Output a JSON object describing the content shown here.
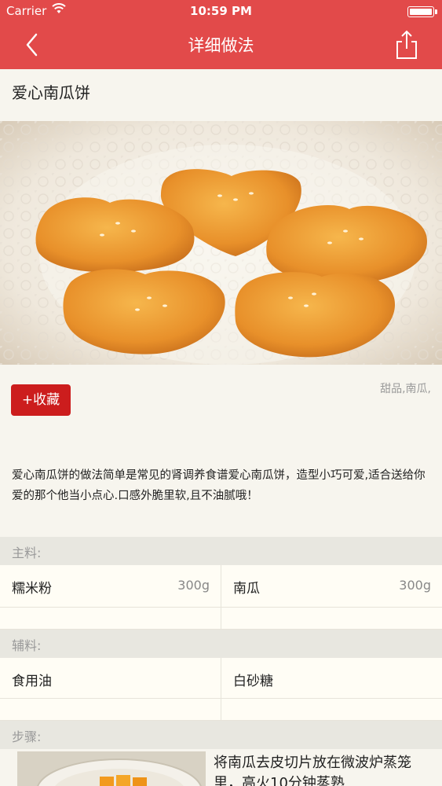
{
  "status": {
    "carrier": "Carrier",
    "time": "10:59 PM"
  },
  "nav": {
    "title": "详细做法",
    "back_icon": "chevron-left-icon",
    "share_icon": "share-icon"
  },
  "recipe": {
    "name": "爱心南瓜饼",
    "favorite_label": "+收藏",
    "tags": "甜品,南瓜,",
    "description": "爱心南瓜饼的做法简单是常见的肾调养食谱爱心南瓜饼，造型小巧可爱,适合送给你爱的那个他当小点心.口感外脆里软,且不油腻哦！"
  },
  "main_ingredients": {
    "label": "主料:",
    "items": [
      {
        "name": "糯米粉",
        "qty": "300g"
      },
      {
        "name": "南瓜",
        "qty": "300g"
      }
    ]
  },
  "aux_ingredients": {
    "label": "辅料:",
    "items": [
      {
        "name": "食用油",
        "qty": ""
      },
      {
        "name": "白砂糖",
        "qty": ""
      }
    ]
  },
  "steps": {
    "label": "步骤:",
    "items": [
      {
        "text": "将南瓜去皮切片放在微波炉蒸笼里，高火10分钟蒸熟"
      }
    ]
  },
  "colors": {
    "brand": "#e24a4a",
    "favorite_button": "#cc1d1d",
    "background": "#f7f5ee"
  }
}
